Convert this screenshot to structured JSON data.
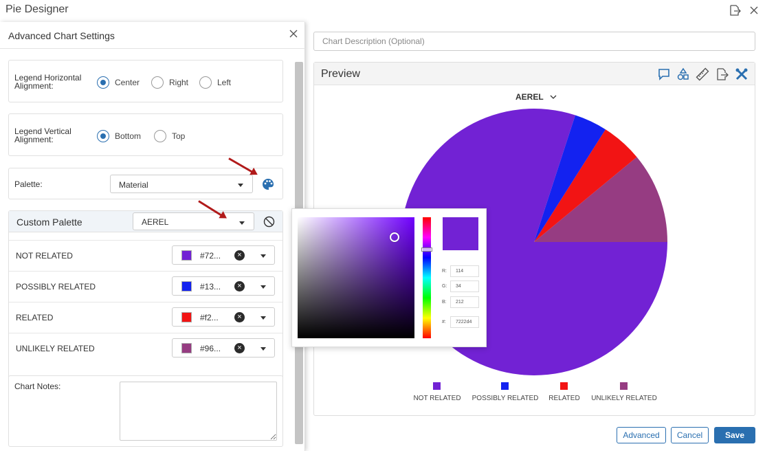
{
  "app": {
    "title": "Pie Designer",
    "icons": [
      "export-icon",
      "close-icon"
    ]
  },
  "panel": {
    "title": "Advanced Chart Settings",
    "legend_h": {
      "label": "Legend Horizontal Alignment:",
      "options": [
        "Center",
        "Right",
        "Left"
      ],
      "selected": "Center"
    },
    "legend_v": {
      "label": "Legend Vertical Alignment:",
      "options": [
        "Bottom",
        "Top"
      ],
      "selected": "Bottom"
    },
    "palette": {
      "label": "Palette:",
      "value": "Material"
    },
    "custom_palette": {
      "label": "Custom Palette",
      "value": "AEREL",
      "rows": [
        {
          "label": "NOT RELATED",
          "hex": "#72...",
          "color": "#7222d4"
        },
        {
          "label": "POSSIBLY RELATED",
          "hex": "#13...",
          "color": "#1322f0"
        },
        {
          "label": "RELATED",
          "hex": "#f2...",
          "color": "#f21414"
        },
        {
          "label": "UNLIKELY RELATED",
          "hex": "#96...",
          "color": "#963c82"
        }
      ]
    },
    "notes": {
      "label": "Chart Notes:"
    }
  },
  "description": {
    "placeholder": "Chart Description (Optional)"
  },
  "preview": {
    "title": "Preview",
    "toolbar_icons": [
      "comment-icon",
      "shapes-icon",
      "ruler-icon",
      "export-icon",
      "tools-icon"
    ],
    "selector": "AEREL"
  },
  "chart_data": {
    "type": "pie",
    "labels": [
      "NOT RELATED",
      "POSSIBLY RELATED",
      "RELATED",
      "UNLIKELY RELATED"
    ],
    "values": [
      80,
      4,
      5,
      11
    ],
    "colors": [
      "#7222d4",
      "#1322f0",
      "#f21414",
      "#963c82"
    ],
    "legend_position": "bottom"
  },
  "color_picker": {
    "r_label": "R:",
    "g_label": "G:",
    "b_label": "B:",
    "hex_label": "#:",
    "r": "114",
    "g": "34",
    "b": "212",
    "hex": "7222d4",
    "color": "#7222d4"
  },
  "buttons": {
    "advanced": "Advanced",
    "cancel": "Cancel",
    "save": "Save"
  }
}
